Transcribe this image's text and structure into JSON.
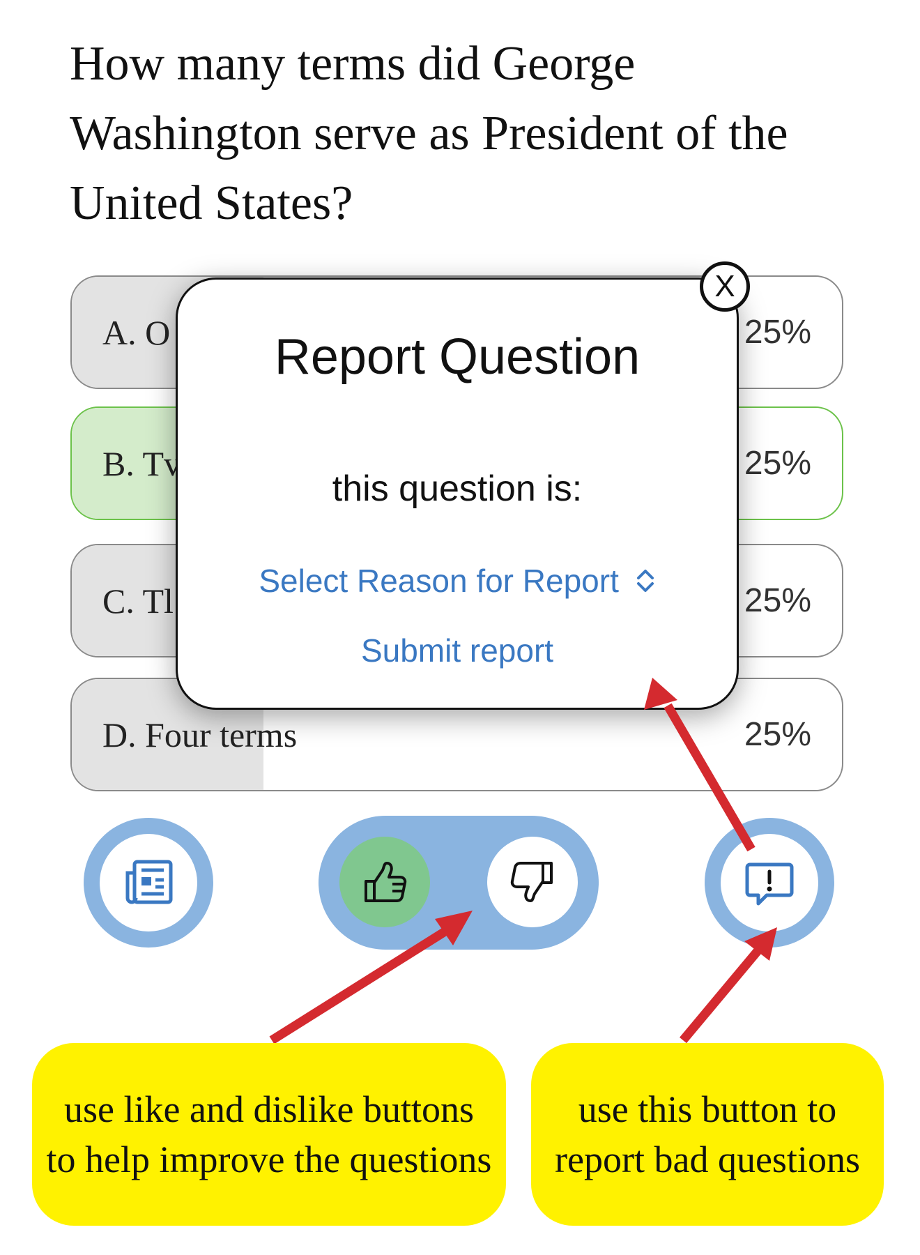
{
  "question": {
    "text": "How many terms did George Washington serve as President of the United States?"
  },
  "options": [
    {
      "label": "A. O",
      "percent": "25%",
      "state": "neutral"
    },
    {
      "label": "B. Tv",
      "percent": "25%",
      "state": "correct"
    },
    {
      "label": "C. Tl",
      "percent": "25%",
      "state": "neutral"
    },
    {
      "label": "D. Four terms",
      "percent": "25%",
      "state": "neutral"
    }
  ],
  "modal": {
    "title": "Report Question",
    "prompt": "this question is:",
    "select_label": "Select Reason for Report",
    "submit_label": "Submit report",
    "close_label": "X"
  },
  "toolbar": {
    "news_icon": "newspaper-icon",
    "like_icon": "thumbs-up-icon",
    "dislike_icon": "thumbs-down-icon",
    "report_icon": "report-message-icon"
  },
  "callouts": {
    "like_dislike": "use like and dislike buttons to help improve the questions",
    "report": "use this button to report bad questions"
  },
  "colors": {
    "accent_blue": "#8ab4e0",
    "link_blue": "#3a78c2",
    "correct_green": "#6cc24a",
    "like_green": "#80c78f",
    "callout_yellow": "#fff200",
    "arrow_red": "#d42a2f"
  }
}
